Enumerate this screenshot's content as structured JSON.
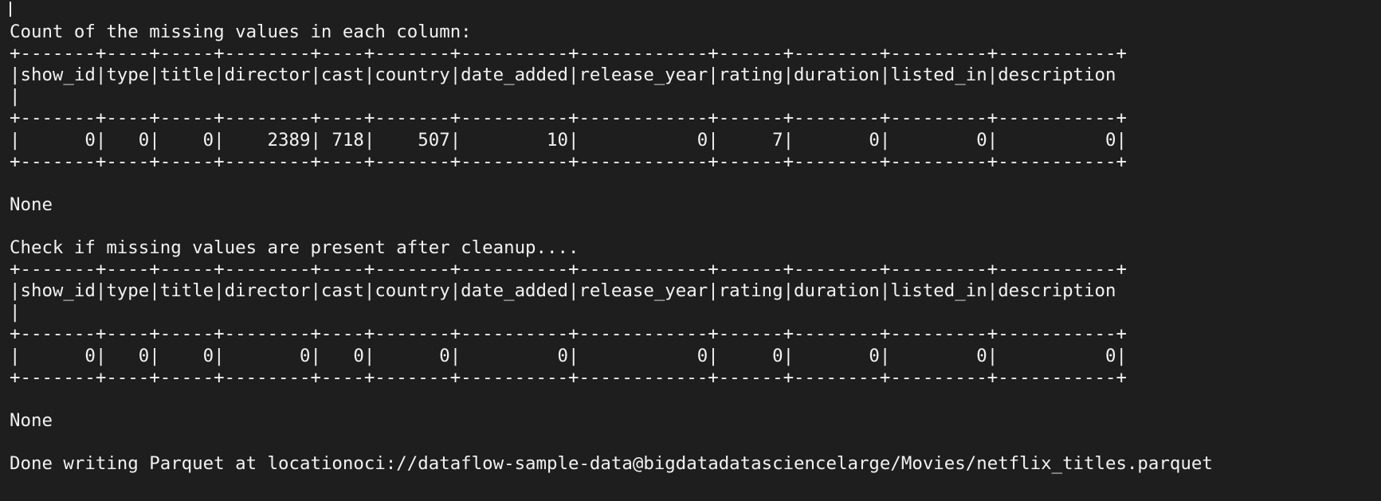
{
  "terminal": {
    "lines": [
      "",
      "Count of the missing values in each column:",
      "+-------+----+-----+--------+----+-------+----------+------------+------+--------+---------+-----------+",
      "|show_id|type|title|director|cast|country|date_added|release_year|rating|duration|listed_in|description",
      "|",
      "+-------+----+-----+--------+----+-------+----------+------------+------+--------+---------+-----------+",
      "|      0|   0|    0|    2389| 718|    507|        10|           0|     7|       0|        0|          0|",
      "+-------+----+-----+--------+----+-------+----------+------------+------+--------+---------+-----------+",
      "",
      "None",
      "",
      "Check if missing values are present after cleanup....",
      "+-------+----+-----+--------+----+-------+----------+------------+------+--------+---------+-----------+",
      "|show_id|type|title|director|cast|country|date_added|release_year|rating|duration|listed_in|description",
      "|",
      "+-------+----+-----+--------+----+-------+----------+------------+------+--------+---------+-----------+",
      "|      0|   0|    0|       0|   0|      0|         0|           0|     0|       0|        0|          0|",
      "+-------+----+-----+--------+----+-------+----------+------------+------+--------+---------+-----------+",
      "",
      "None",
      "",
      "Done writing Parquet at locationoci://dataflow-sample-data@bigdatadatasciencelarge/Movies/netflix_titles.parquet",
      ""
    ]
  }
}
